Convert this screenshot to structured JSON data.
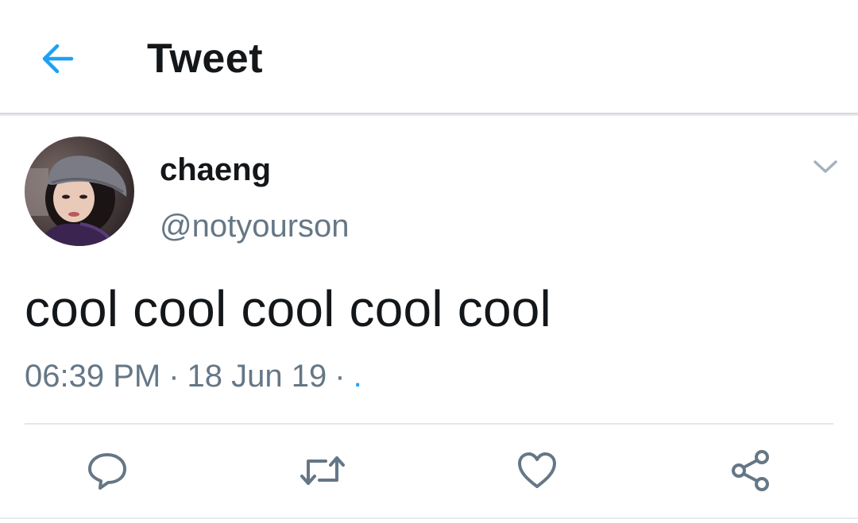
{
  "header": {
    "back_icon": "arrow-left-icon",
    "title": "Tweet",
    "accent_color": "#1da1f2"
  },
  "tweet": {
    "author": {
      "display_name": "chaeng",
      "handle": "@notyourson",
      "avatar": "profile-photo"
    },
    "menu_icon": "chevron-down-icon",
    "text": "cool cool cool cool cool",
    "time": "06:39 PM",
    "separator": "·",
    "date": "18 Jun 19",
    "source": "."
  },
  "actions": [
    {
      "name": "reply",
      "icon": "comment-icon"
    },
    {
      "name": "retweet",
      "icon": "retweet-icon"
    },
    {
      "name": "like",
      "icon": "heart-icon"
    },
    {
      "name": "share",
      "icon": "share-icon"
    }
  ],
  "colors": {
    "primary_text": "#14171a",
    "secondary_text": "#657786",
    "icon_gray": "#657786",
    "divider": "#e1e8ed"
  }
}
